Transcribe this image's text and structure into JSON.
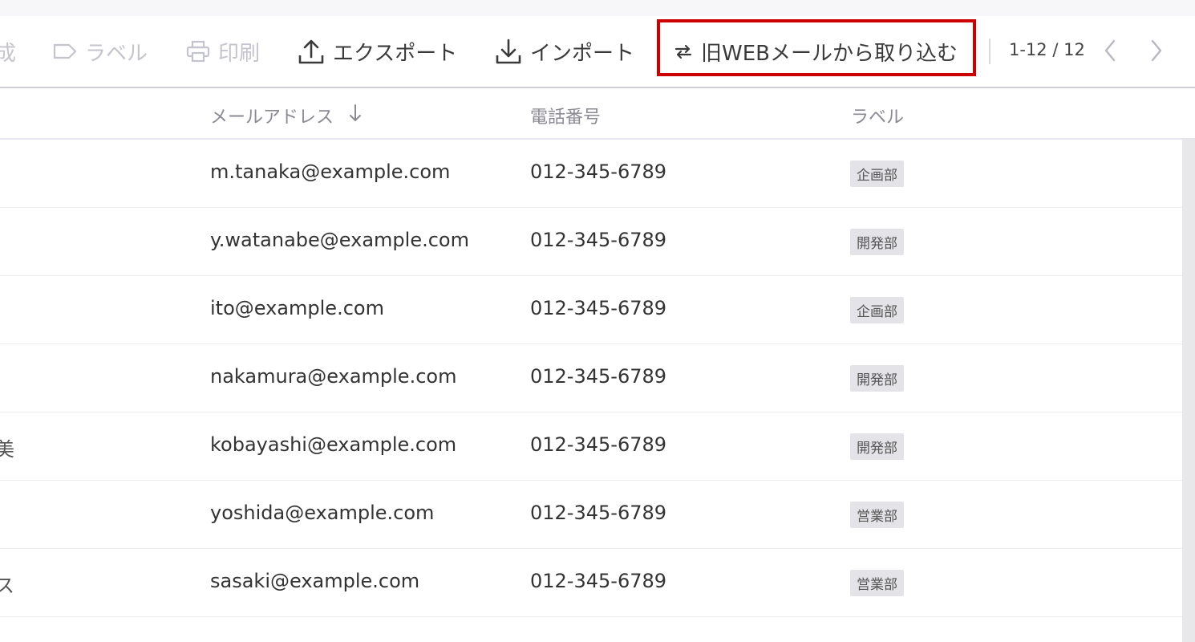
{
  "toolbar": {
    "create_label": "成",
    "label_label": "ラベル",
    "print_label": "印刷",
    "export_label": "エクスポート",
    "import_label": "インポート",
    "legacy_import_label": "旧WEBメールから取り込む",
    "pagination": "1-12 / 12"
  },
  "table": {
    "headers": {
      "email": "メールアドレス",
      "phone": "電話番号",
      "label": "ラベル"
    },
    "rows": [
      {
        "name_fragment": "",
        "email": "m.tanaka@example.com",
        "phone": "012-345-6789",
        "label": "企画部"
      },
      {
        "name_fragment": "",
        "email": "y.watanabe@example.com",
        "phone": "012-345-6789",
        "label": "開発部"
      },
      {
        "name_fragment": "",
        "email": "ito@example.com",
        "phone": "012-345-6789",
        "label": "企画部"
      },
      {
        "name_fragment": "",
        "email": "nakamura@example.com",
        "phone": "012-345-6789",
        "label": "開発部"
      },
      {
        "name_fragment": "美",
        "email": "kobayashi@example.com",
        "phone": "012-345-6789",
        "label": "開発部"
      },
      {
        "name_fragment": "",
        "email": "yoshida@example.com",
        "phone": "012-345-6789",
        "label": "営業部"
      },
      {
        "name_fragment": "ス",
        "email": "sasaki@example.com",
        "phone": "012-345-6789",
        "label": "営業部"
      }
    ]
  },
  "icons": {
    "create": "create-icon",
    "label": "label-tag-icon",
    "print": "printer-icon",
    "export": "upload-icon",
    "import": "download-icon",
    "legacy_import": "swap-arrows-icon",
    "prev": "chevron-left-icon",
    "next": "chevron-right-icon",
    "sort": "arrow-down-icon"
  },
  "colors": {
    "highlight": "#cc0000",
    "disabled_text": "#c4c4cc",
    "tag_bg": "#e4e4e8"
  }
}
